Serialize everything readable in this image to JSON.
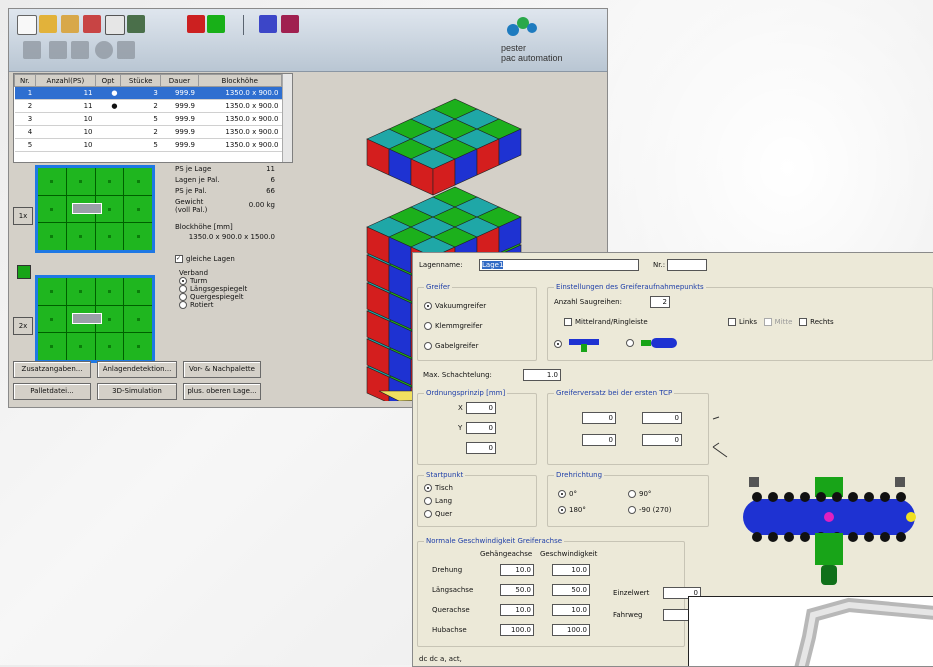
{
  "window1": {
    "logo": {
      "line1": "pester",
      "line2": "pac automation"
    },
    "table": {
      "headers": [
        "Nr.",
        "Anzahl(PS)",
        "Opt",
        "Stücke",
        "Dauer",
        "Blockhöhe"
      ],
      "rows": [
        [
          "1",
          "11",
          "●",
          "3",
          "999.9",
          "1350.0 x 900.0"
        ],
        [
          "2",
          "11",
          "●",
          "2",
          "999.9",
          "1350.0 x 900.0"
        ],
        [
          "3",
          "10",
          "",
          "5",
          "999.9",
          "1350.0 x 900.0"
        ],
        [
          "4",
          "10",
          "",
          "2",
          "999.9",
          "1350.0 x 900.0"
        ],
        [
          "5",
          "10",
          "",
          "5",
          "999.9",
          "1350.0 x 900.0"
        ]
      ]
    },
    "info": [
      {
        "label": "PS je Lage",
        "value": "11"
      },
      {
        "label": "Lagen je Pal.",
        "value": "6"
      },
      {
        "label": "PS je Pal.",
        "value": "66"
      },
      {
        "label": "Gewicht (voll Pal.)",
        "value": "0.00 kg"
      },
      {
        "label": "Blockhöhe [mm]",
        "value": ""
      }
    ],
    "block_size": "1350.0 x 900.0 x 1500.0",
    "same_layers": "gleiche Lagen",
    "verband_label": "Verband",
    "verband_options": [
      {
        "label": "Turm",
        "on": true
      },
      {
        "label": "Längsgespiegelt",
        "on": false
      },
      {
        "label": "Quergespiegelt",
        "on": false
      },
      {
        "label": "Rotiert",
        "on": false
      }
    ],
    "layer_buttons": [
      "1x",
      "2x"
    ],
    "buttons_row1": [
      "Zusatzangaben...",
      "Anlagendetektion...",
      "Vor- & Nachpalette"
    ],
    "buttons_row2": [
      "Palletdatei...",
      "3D-Simulation",
      "plus. oberen Lage..."
    ]
  },
  "window2": {
    "name_label": "Lagenname:",
    "name_value": "Lage1",
    "nr_label": "Nr.:",
    "greifer_group": "Greifer",
    "greifer_options": [
      {
        "label": "Vakuumgreifer",
        "on": true
      },
      {
        "label": "Klemmgreifer",
        "on": false
      },
      {
        "label": "Gabelgreifer",
        "on": false
      }
    ],
    "setup_group": "Einstellungen des Greiferaufnahmepunkts",
    "anzahl_label": "Anzahl Saugreihen:",
    "anzahl_value": "2",
    "checkbox_label": "Mittelrand/Ringleiste",
    "sides": [
      "Links",
      "Mitte",
      "Rechts"
    ],
    "max_label": "Max. Schachtelung:",
    "max_value": "1.0",
    "ordnung_group": "Ordnungsprinzip [mm]",
    "ordnung_values": [
      "0",
      "0",
      "0"
    ],
    "offset_group": "Greiferversatz bei der ersten TCP",
    "offsets": [
      [
        "0",
        "0"
      ],
      [
        "0",
        "0"
      ]
    ],
    "start_group": "Startpunkt",
    "start_options": [
      {
        "label": "Tisch",
        "on": true
      },
      {
        "label": "Lang",
        "on": false
      },
      {
        "label": "Quer",
        "on": false
      }
    ],
    "rot_group": "Drehrichtung",
    "rot_options": [
      {
        "label": "0°",
        "on": true
      },
      {
        "label": "90°",
        "on": false
      },
      {
        "label": "180°",
        "on": true
      },
      {
        "label": "-90 (270)",
        "on": false
      }
    ],
    "normal_group": "Normale Geschwindigkeit Greiferachse",
    "col_heads": [
      "Gehängeachse",
      "Geschwindigkeit"
    ],
    "rows": [
      {
        "label": "Drehung",
        "a": "10.0",
        "b": "10.0"
      },
      {
        "label": "Längsachse",
        "a": "50.0",
        "b": "50.0"
      },
      {
        "label": "Querachse",
        "a": "10.0",
        "b": "10.0"
      },
      {
        "label": "Hubachse",
        "a": "100.0",
        "b": "100.0"
      }
    ],
    "extra": [
      {
        "label": "Einzelwert",
        "v": "0"
      },
      {
        "label": "Fahrweg",
        "v": "0"
      }
    ],
    "bottom_text": "dc dc a, act, "
  },
  "colors": {
    "pallet_red": "#d41e1e",
    "pallet_blue": "#1e32d2",
    "pallet_teal": "#1fa7a7",
    "pallet_green": "#1cb01c",
    "selection": "#2f6fd0"
  }
}
